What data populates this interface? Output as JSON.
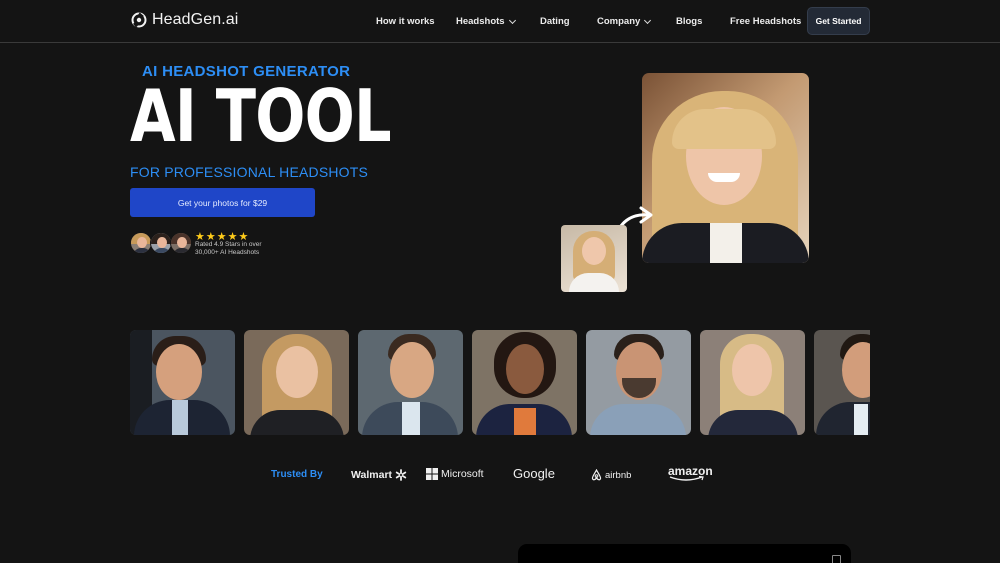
{
  "nav": {
    "logo_text": "HeadGen.ai",
    "items": [
      {
        "label": "How it works",
        "dropdown": false
      },
      {
        "label": "Headshots",
        "dropdown": true
      },
      {
        "label": "Dating",
        "dropdown": false
      },
      {
        "label": "Company",
        "dropdown": true
      },
      {
        "label": "Blogs",
        "dropdown": false
      },
      {
        "label": "Free Headshots",
        "dropdown": false
      }
    ],
    "cta_label": "Get Started"
  },
  "hero": {
    "eyebrow": "AI HEADSHOT GENERATOR",
    "title": "AI TOOL",
    "subtitle": "FOR PROFESSIONAL HEADSHOTS",
    "cta_label": "Get your photos for $29",
    "stars": "★★★★★",
    "rating_line1": "Rated 4.9 Stars in over",
    "rating_line2": "30,000+ AI Headshots"
  },
  "trusted": {
    "label": "Trusted By",
    "brands": [
      "Walmart",
      "Microsoft",
      "Google",
      "airbnb",
      "amazon"
    ]
  },
  "colors": {
    "accent": "#2d8ef5",
    "cta": "#1f46c8",
    "background": "#141414",
    "star": "#ffcc1a"
  }
}
